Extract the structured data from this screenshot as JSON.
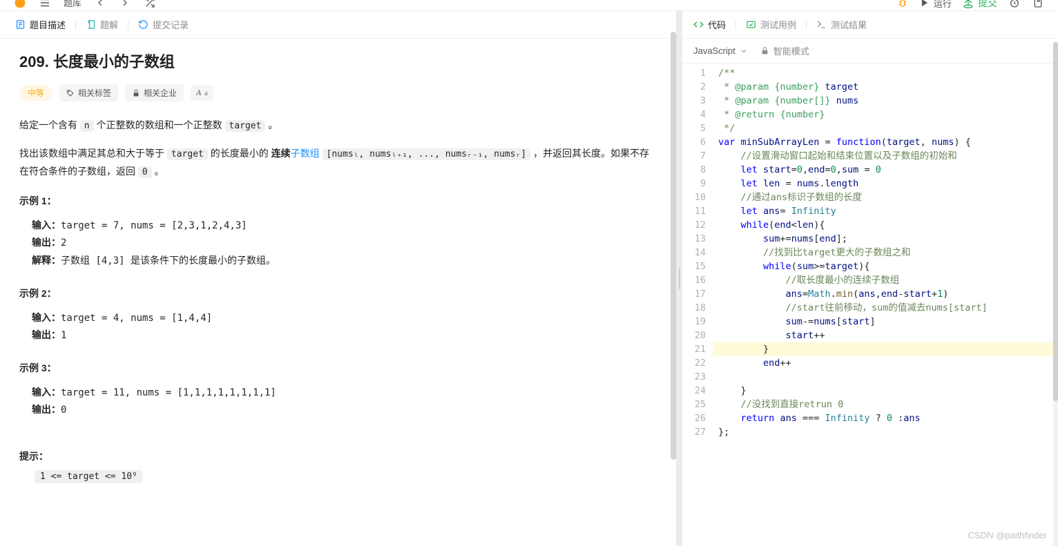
{
  "topbar": {
    "library": "题库",
    "run": "运行",
    "submit": "提交"
  },
  "problem_tabs": {
    "description": "题目描述",
    "solution": "题解",
    "submissions": "提交记录"
  },
  "problem": {
    "title": "209. 长度最小的子数组",
    "difficulty": "中等",
    "tags_label": "相关标签",
    "companies_label": "相关企业",
    "desc1_pre": "给定一个含有 ",
    "desc1_n": "n",
    "desc1_mid": " 个正整数的数组和一个正整数 ",
    "desc1_target": "target",
    "desc1_end": " 。",
    "desc2_pre": "找出该数组中满足其总和大于等于 ",
    "desc2_target": "target",
    "desc2_mid": " 的长度最小的 ",
    "desc2_bold": "连续",
    "desc2_link": "子数组",
    "desc2_array": "[numsₗ, numsₗ₊₁, ..., numsᵣ₋₁, numsᵣ]",
    "desc2_post": " ，并返回其长度。如果不存在符合条件的子数组，返回 ",
    "desc2_zero": "0",
    "desc2_end": " 。",
    "example1_title": "示例 1：",
    "example1": {
      "input_lbl": "输入：",
      "input": "target = 7, nums = [2,3,1,2,4,3]",
      "output_lbl": "输出：",
      "output": "2",
      "explain_lbl": "解释：",
      "explain_pre": "子数组 ",
      "explain_code": "[4,3]",
      "explain_post": " 是该条件下的长度最小的子数组。"
    },
    "example2_title": "示例 2：",
    "example2": {
      "input_lbl": "输入：",
      "input": "target = 4, nums = [1,4,4]",
      "output_lbl": "输出：",
      "output": "1"
    },
    "example3_title": "示例 3：",
    "example3": {
      "input_lbl": "输入：",
      "input": "target = 11, nums = [1,1,1,1,1,1,1,1]",
      "output_lbl": "输出：",
      "output": "0"
    },
    "hints_title": "提示：",
    "hints": [
      "1 <= target <= 10⁹"
    ]
  },
  "code_tabs": {
    "code": "代码",
    "testcase": "测试用例",
    "result": "测试结果"
  },
  "editor": {
    "language": "JavaScript",
    "smart_mode": "智能模式",
    "watermark": "CSDN @paithfinder",
    "lines": [
      {
        "n": 1,
        "seg": [
          {
            "c": "tok-comment",
            "t": "/**"
          }
        ]
      },
      {
        "n": 2,
        "seg": [
          {
            "c": "tok-comment",
            "t": " * "
          },
          {
            "c": "tok-docparam",
            "t": "@param"
          },
          {
            "c": "tok-comment",
            "t": " "
          },
          {
            "c": "tok-docparam",
            "t": "{number}"
          },
          {
            "c": "tok-comment",
            "t": " "
          },
          {
            "c": "tok-prop",
            "t": "target"
          }
        ]
      },
      {
        "n": 3,
        "seg": [
          {
            "c": "tok-comment",
            "t": " * "
          },
          {
            "c": "tok-docparam",
            "t": "@param"
          },
          {
            "c": "tok-comment",
            "t": " "
          },
          {
            "c": "tok-docparam",
            "t": "{number[]}"
          },
          {
            "c": "tok-comment",
            "t": " "
          },
          {
            "c": "tok-prop",
            "t": "nums"
          }
        ]
      },
      {
        "n": 4,
        "seg": [
          {
            "c": "tok-comment",
            "t": " * "
          },
          {
            "c": "tok-docparam",
            "t": "@return"
          },
          {
            "c": "tok-comment",
            "t": " "
          },
          {
            "c": "tok-docparam",
            "t": "{number}"
          }
        ]
      },
      {
        "n": 5,
        "seg": [
          {
            "c": "tok-comment",
            "t": " */"
          }
        ]
      },
      {
        "n": 6,
        "seg": [
          {
            "c": "tok-keyword",
            "t": "var"
          },
          {
            "c": "",
            "t": " "
          },
          {
            "c": "tok-prop",
            "t": "minSubArrayLen"
          },
          {
            "c": "",
            "t": " = "
          },
          {
            "c": "tok-keyword",
            "t": "function"
          },
          {
            "c": "",
            "t": "("
          },
          {
            "c": "tok-prop",
            "t": "target"
          },
          {
            "c": "",
            "t": ", "
          },
          {
            "c": "tok-prop",
            "t": "nums"
          },
          {
            "c": "",
            "t": ") {"
          }
        ]
      },
      {
        "n": 7,
        "indent": 1,
        "seg": [
          {
            "c": "tok-comment",
            "t": "//设置滑动窗口起始和结束位置以及子数组的初始和"
          }
        ]
      },
      {
        "n": 8,
        "indent": 1,
        "seg": [
          {
            "c": "tok-keyword",
            "t": "let"
          },
          {
            "c": "",
            "t": " "
          },
          {
            "c": "tok-prop",
            "t": "start"
          },
          {
            "c": "",
            "t": "="
          },
          {
            "c": "tok-number",
            "t": "0"
          },
          {
            "c": "",
            "t": ","
          },
          {
            "c": "tok-prop",
            "t": "end"
          },
          {
            "c": "",
            "t": "="
          },
          {
            "c": "tok-number",
            "t": "0"
          },
          {
            "c": "",
            "t": ","
          },
          {
            "c": "tok-prop",
            "t": "sum"
          },
          {
            "c": "",
            "t": " = "
          },
          {
            "c": "tok-number",
            "t": "0"
          }
        ]
      },
      {
        "n": 9,
        "indent": 1,
        "seg": [
          {
            "c": "tok-keyword",
            "t": "let"
          },
          {
            "c": "",
            "t": " "
          },
          {
            "c": "tok-prop",
            "t": "len"
          },
          {
            "c": "",
            "t": " = "
          },
          {
            "c": "tok-prop",
            "t": "nums"
          },
          {
            "c": "",
            "t": "."
          },
          {
            "c": "tok-prop",
            "t": "length"
          }
        ]
      },
      {
        "n": 10,
        "indent": 1,
        "seg": [
          {
            "c": "tok-comment",
            "t": "//通过ans标识子数组的长度"
          }
        ]
      },
      {
        "n": 11,
        "indent": 1,
        "seg": [
          {
            "c": "tok-keyword",
            "t": "let"
          },
          {
            "c": "",
            "t": " "
          },
          {
            "c": "tok-prop",
            "t": "ans"
          },
          {
            "c": "",
            "t": "= "
          },
          {
            "c": "tok-builtin",
            "t": "Infinity"
          }
        ]
      },
      {
        "n": 12,
        "indent": 1,
        "seg": [
          {
            "c": "tok-keyword",
            "t": "while"
          },
          {
            "c": "",
            "t": "("
          },
          {
            "c": "tok-prop",
            "t": "end"
          },
          {
            "c": "",
            "t": "<"
          },
          {
            "c": "tok-prop",
            "t": "len"
          },
          {
            "c": "",
            "t": "){"
          }
        ]
      },
      {
        "n": 13,
        "indent": 2,
        "seg": [
          {
            "c": "tok-prop",
            "t": "sum"
          },
          {
            "c": "",
            "t": "+="
          },
          {
            "c": "tok-prop",
            "t": "nums"
          },
          {
            "c": "",
            "t": "["
          },
          {
            "c": "tok-prop",
            "t": "end"
          },
          {
            "c": "",
            "t": "];"
          }
        ]
      },
      {
        "n": 14,
        "indent": 2,
        "seg": [
          {
            "c": "tok-comment",
            "t": "//找到比target更大的子数组之和"
          }
        ]
      },
      {
        "n": 15,
        "indent": 2,
        "seg": [
          {
            "c": "tok-keyword",
            "t": "while"
          },
          {
            "c": "",
            "t": "("
          },
          {
            "c": "tok-prop",
            "t": "sum"
          },
          {
            "c": "",
            "t": ">="
          },
          {
            "c": "tok-prop",
            "t": "target"
          },
          {
            "c": "",
            "t": "){"
          }
        ]
      },
      {
        "n": 16,
        "indent": 3,
        "seg": [
          {
            "c": "tok-comment",
            "t": "//取长度最小的连续子数组"
          }
        ]
      },
      {
        "n": 17,
        "indent": 3,
        "seg": [
          {
            "c": "tok-prop",
            "t": "ans"
          },
          {
            "c": "",
            "t": "="
          },
          {
            "c": "tok-builtin",
            "t": "Math"
          },
          {
            "c": "",
            "t": "."
          },
          {
            "c": "tok-func",
            "t": "min"
          },
          {
            "c": "",
            "t": "("
          },
          {
            "c": "tok-prop",
            "t": "ans"
          },
          {
            "c": "",
            "t": ","
          },
          {
            "c": "tok-prop",
            "t": "end"
          },
          {
            "c": "",
            "t": "-"
          },
          {
            "c": "tok-prop",
            "t": "start"
          },
          {
            "c": "",
            "t": "+"
          },
          {
            "c": "tok-number",
            "t": "1"
          },
          {
            "c": "",
            "t": ")"
          }
        ]
      },
      {
        "n": 18,
        "indent": 3,
        "seg": [
          {
            "c": "tok-comment",
            "t": "//start往前移动，sum的值减去nums[start]"
          }
        ]
      },
      {
        "n": 19,
        "indent": 3,
        "seg": [
          {
            "c": "tok-prop",
            "t": "sum"
          },
          {
            "c": "",
            "t": "-="
          },
          {
            "c": "tok-prop",
            "t": "nums"
          },
          {
            "c": "",
            "t": "["
          },
          {
            "c": "tok-prop",
            "t": "start"
          },
          {
            "c": "",
            "t": "]"
          }
        ]
      },
      {
        "n": 20,
        "indent": 3,
        "seg": [
          {
            "c": "tok-prop",
            "t": "start"
          },
          {
            "c": "",
            "t": "++"
          }
        ]
      },
      {
        "n": 21,
        "indent": 2,
        "cursor": true,
        "seg": [
          {
            "c": "",
            "t": "}"
          }
        ]
      },
      {
        "n": 22,
        "indent": 2,
        "seg": [
          {
            "c": "tok-prop",
            "t": "end"
          },
          {
            "c": "",
            "t": "++"
          }
        ]
      },
      {
        "n": 23,
        "indent": 0,
        "seg": [
          {
            "c": "",
            "t": ""
          }
        ]
      },
      {
        "n": 24,
        "indent": 1,
        "seg": [
          {
            "c": "",
            "t": "}"
          }
        ]
      },
      {
        "n": 25,
        "indent": 1,
        "seg": [
          {
            "c": "tok-comment",
            "t": "//没找到直接retrun 0"
          }
        ]
      },
      {
        "n": 26,
        "indent": 1,
        "seg": [
          {
            "c": "tok-keyword",
            "t": "return"
          },
          {
            "c": "",
            "t": " "
          },
          {
            "c": "tok-prop",
            "t": "ans"
          },
          {
            "c": "",
            "t": " === "
          },
          {
            "c": "tok-builtin",
            "t": "Infinity"
          },
          {
            "c": "",
            "t": " ? "
          },
          {
            "c": "tok-number",
            "t": "0"
          },
          {
            "c": "",
            "t": " :"
          },
          {
            "c": "tok-prop",
            "t": "ans"
          }
        ]
      },
      {
        "n": 27,
        "seg": [
          {
            "c": "",
            "t": "};"
          }
        ]
      }
    ]
  }
}
